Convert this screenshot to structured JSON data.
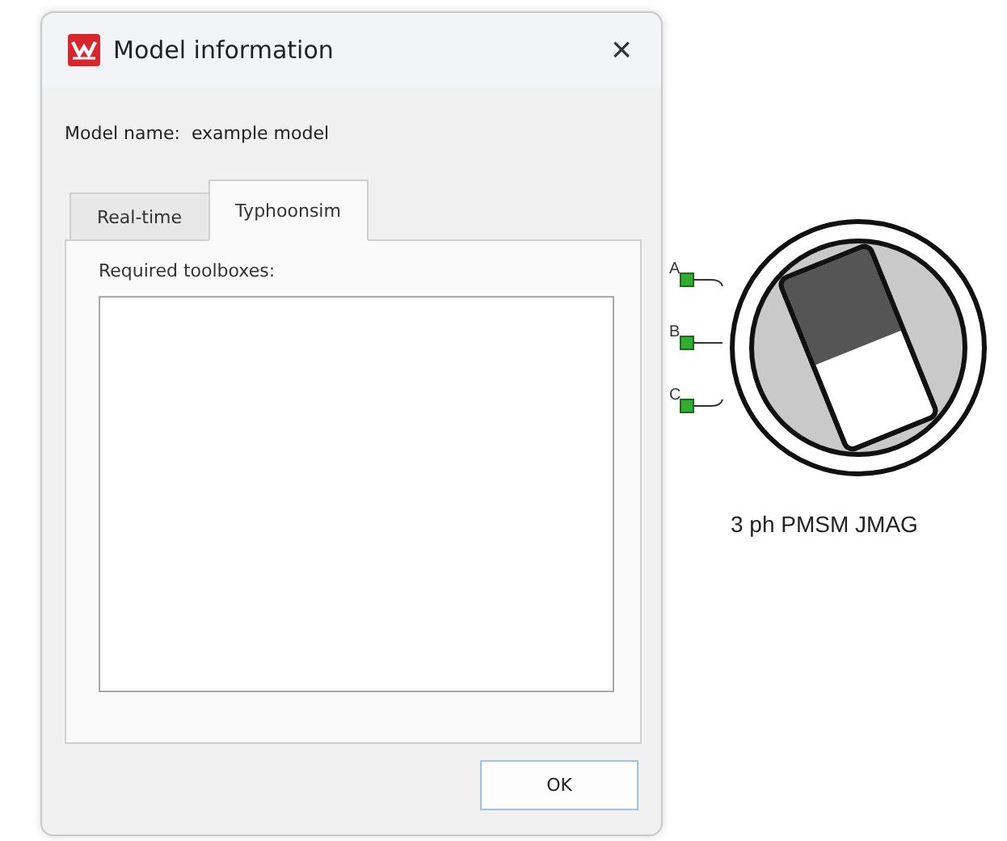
{
  "dialog": {
    "title": "Model information",
    "close": "×",
    "model_name_label": "Model name:",
    "model_name": "example model",
    "tabs": [
      {
        "label": "Real-time",
        "selected": false
      },
      {
        "label": "Typhoonsim",
        "selected": true
      }
    ],
    "list_label": "Required toolboxes:",
    "buttons": [
      "OK"
    ]
  },
  "component": {
    "label": "3 ph PMSM JMAG",
    "ports": [
      {
        "label": "A"
      },
      {
        "label": "B"
      },
      {
        "label": "C"
      }
    ]
  }
}
